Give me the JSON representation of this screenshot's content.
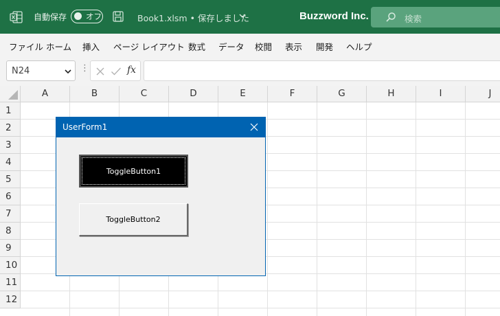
{
  "titlebar": {
    "autosave_label": "自動保存",
    "autosave_state": "オフ",
    "filename": "Book1.xlsm • 保存しました",
    "company": "Buzzword Inc.",
    "search_placeholder": "検索",
    "background_color": "#1e7145"
  },
  "menu": [
    "ファイル",
    "ホーム",
    "挿入",
    "ページ レイアウト",
    "数式",
    "データ",
    "校閲",
    "表示",
    "開発",
    "ヘルプ"
  ],
  "formula_bar": {
    "name_box": "N24",
    "formula": ""
  },
  "grid": {
    "columns": [
      "A",
      "B",
      "C",
      "D",
      "E",
      "F",
      "G",
      "H",
      "I",
      "J"
    ],
    "rows": [
      "1",
      "2",
      "3",
      "4",
      "5",
      "6",
      "7",
      "8",
      "9",
      "10",
      "11",
      "12"
    ]
  },
  "userform": {
    "title": "UserForm1",
    "title_color": "#0063b1",
    "buttons": [
      {
        "label": "ToggleButton1",
        "state": "pressed"
      },
      {
        "label": "ToggleButton2",
        "state": "released"
      }
    ]
  }
}
